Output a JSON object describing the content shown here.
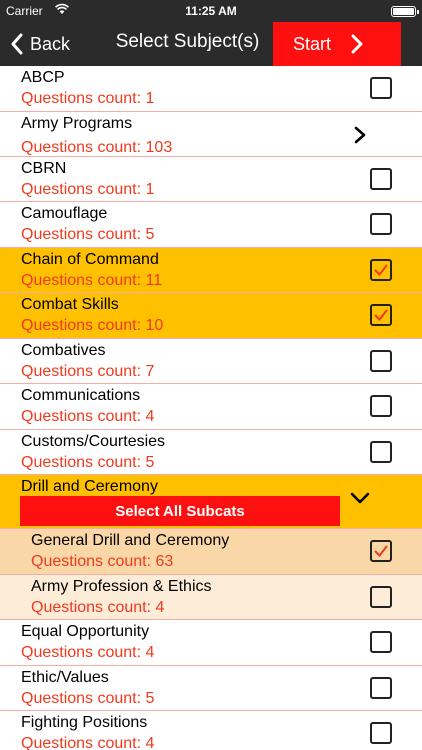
{
  "status_bar": {
    "carrier": "Carrier",
    "time": "11:25 AM"
  },
  "nav": {
    "back_label": "Back",
    "title": "Select Subject(s)",
    "start_label": "Start"
  },
  "colors": {
    "bar": "#2b2b2b",
    "accent_red": "#ff1010",
    "selected": "#ffc000",
    "count_text": "#f03a1e"
  },
  "subjects": [
    {
      "name": "ABCP",
      "count": "Questions count: 1",
      "checked": false
    },
    {
      "name": "Army Programs",
      "count": "Questions count: 103",
      "has_children": true
    },
    {
      "name": "CBRN",
      "count": "Questions count: 1",
      "checked": false
    },
    {
      "name": "Camouflage",
      "count": "Questions count: 5",
      "checked": false
    },
    {
      "name": "Chain of Command",
      "count": "Questions count: 11",
      "checked": true
    },
    {
      "name": "Combat Skills",
      "count": "Questions count: 10",
      "checked": true
    },
    {
      "name": "Combatives",
      "count": "Questions count: 7",
      "checked": false
    },
    {
      "name": "Communications",
      "count": "Questions count: 4",
      "checked": false
    },
    {
      "name": "Customs/Courtesies",
      "count": "Questions count: 5",
      "checked": false
    }
  ],
  "group": {
    "name": "Drill and Ceremony",
    "select_all_label": "Select All Subcats",
    "expanded": true,
    "subcats": [
      {
        "name": "General Drill and Ceremony",
        "count": "Questions count: 63",
        "checked": true
      },
      {
        "name": "Army Profession & Ethics",
        "count": "Questions count: 4",
        "checked": false
      }
    ]
  },
  "subjects_after": [
    {
      "name": "Equal Opportunity",
      "count": "Questions count: 4",
      "checked": false
    },
    {
      "name": "Ethic/Values",
      "count": "Questions count: 5",
      "checked": false
    },
    {
      "name": "Fighting Positions",
      "count": "Questions count: 4",
      "checked": false
    }
  ]
}
